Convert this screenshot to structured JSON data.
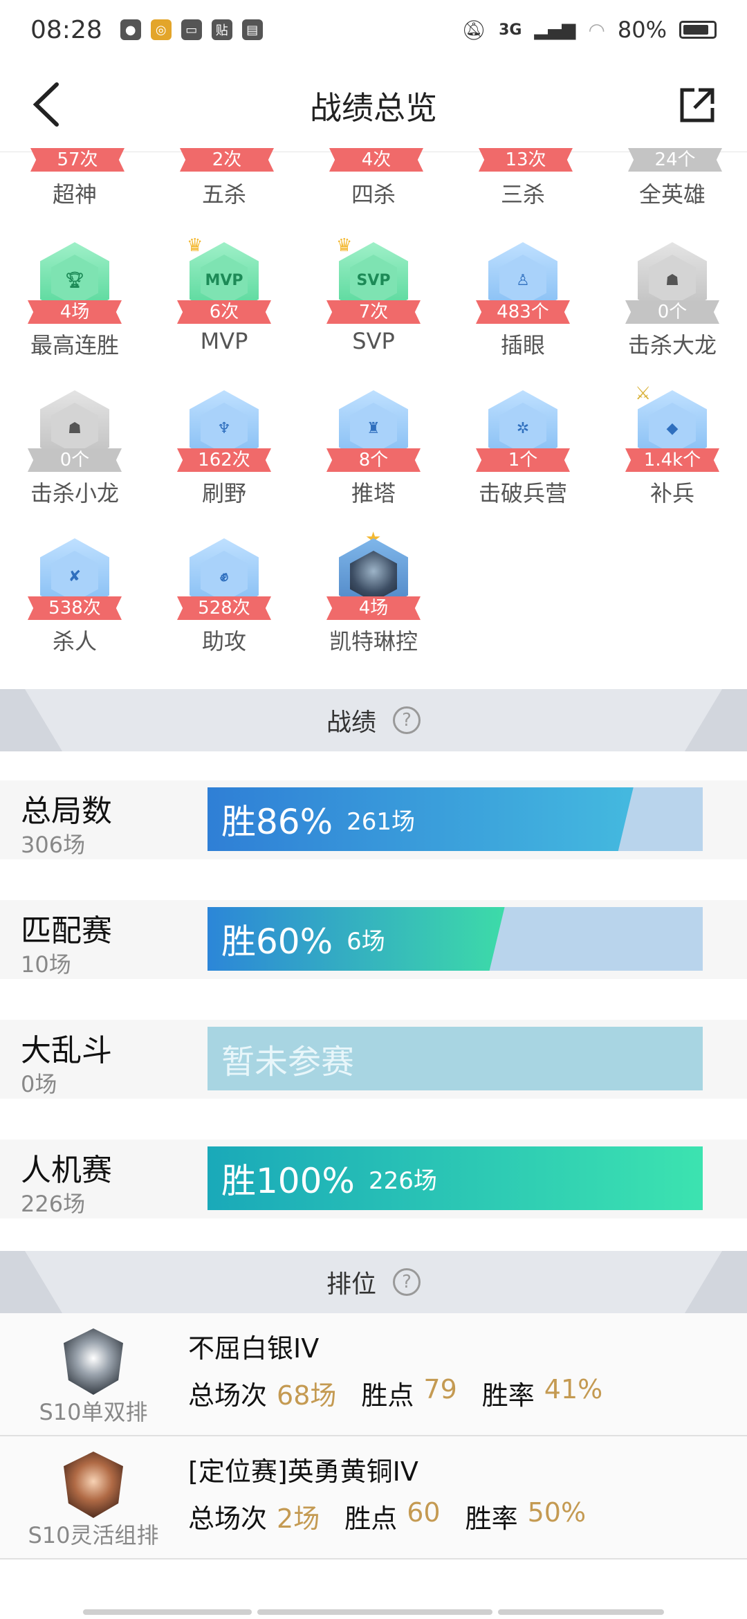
{
  "status_bar": {
    "time": "08:28",
    "network": "3G",
    "battery": "80%"
  },
  "header": {
    "title": "战绩总览"
  },
  "achievements": [
    {
      "count": "57次",
      "label": "超神",
      "style": "red",
      "icon": "crown-icon"
    },
    {
      "count": "2次",
      "label": "五杀",
      "style": "red",
      "icon": "kill-icon"
    },
    {
      "count": "4次",
      "label": "四杀",
      "style": "red",
      "icon": "kill-icon"
    },
    {
      "count": "13次",
      "label": "三杀",
      "style": "red",
      "icon": "kill-icon"
    },
    {
      "count": "24个",
      "label": "全英雄",
      "style": "gray",
      "icon": "hero-icon"
    },
    {
      "count": "4场",
      "label": "最高连胜",
      "style": "green",
      "icon": "trophy-icon"
    },
    {
      "count": "6次",
      "label": "MVP",
      "style": "green",
      "icon": "mvp-icon",
      "badge": "MVP"
    },
    {
      "count": "7次",
      "label": "SVP",
      "style": "green",
      "icon": "svp-icon",
      "badge": "SVP"
    },
    {
      "count": "483个",
      "label": "插眼",
      "style": "blue",
      "icon": "ward-icon"
    },
    {
      "count": "0个",
      "label": "击杀大龙",
      "style": "gray",
      "icon": "dragon-icon"
    },
    {
      "count": "0个",
      "label": "击杀小龙",
      "style": "gray",
      "icon": "dragon-icon"
    },
    {
      "count": "162次",
      "label": "刷野",
      "style": "blue",
      "icon": "jungle-icon"
    },
    {
      "count": "8个",
      "label": "推塔",
      "style": "blue",
      "icon": "tower-icon"
    },
    {
      "count": "1个",
      "label": "击破兵营",
      "style": "blue",
      "icon": "barracks-icon"
    },
    {
      "count": "1.4k个",
      "label": "补兵",
      "style": "blue",
      "icon": "minion-icon"
    },
    {
      "count": "538次",
      "label": "杀人",
      "style": "blue",
      "icon": "sword-icon"
    },
    {
      "count": "528次",
      "label": "助攻",
      "style": "blue",
      "icon": "assist-icon"
    },
    {
      "count": "4场",
      "label": "凯特琳控",
      "style": "portrait",
      "icon": "champion-portrait"
    }
  ],
  "record_section": {
    "title": "战绩"
  },
  "records": [
    {
      "name": "总局数",
      "total": "306场",
      "win_label": "胜86%",
      "wins": "261场",
      "rate": 0.86,
      "colors": [
        "#2f7fd6",
        "#44b9df"
      ]
    },
    {
      "name": "匹配赛",
      "total": "10场",
      "win_label": "胜60%",
      "wins": "6场",
      "rate": 0.6,
      "colors": [
        "#2c86d8",
        "#3ddba8"
      ]
    },
    {
      "name": "大乱斗",
      "total": "0场",
      "empty_label": "暂未参赛",
      "rate": 0
    },
    {
      "name": "人机赛",
      "total": "226场",
      "win_label": "胜100%",
      "wins": "226场",
      "rate": 1.0,
      "colors": [
        "#1aa9b9",
        "#3ce3b0"
      ]
    }
  ],
  "rank_section": {
    "title": "排位"
  },
  "ranks": [
    {
      "mode": "S10单双排",
      "tier": "不屈白银IV",
      "total_label": "总场次",
      "total": "68场",
      "points_label": "胜点",
      "points": "79",
      "rate_label": "胜率",
      "rate": "41%",
      "emblem": "silver"
    },
    {
      "mode": "S10灵活组排",
      "tier": "[定位赛]英勇黄铜IV",
      "total_label": "总场次",
      "total": "2场",
      "points_label": "胜点",
      "points": "60",
      "rate_label": "胜率",
      "rate": "50%",
      "emblem": "bronze"
    }
  ]
}
